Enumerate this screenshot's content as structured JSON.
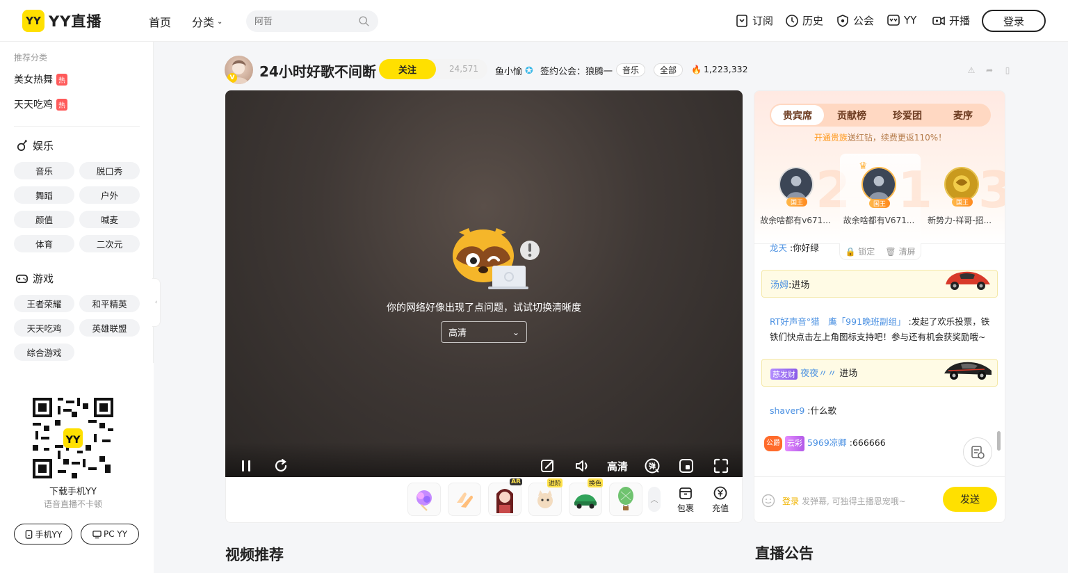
{
  "header": {
    "logo_badge": "YY",
    "logo_text": "YY直播",
    "nav_home": "首页",
    "nav_category": "分类",
    "search_placeholder": "阿哲",
    "nav_items": [
      "订阅",
      "历史",
      "公会",
      "YY",
      "开播"
    ],
    "login": "登录"
  },
  "sidebar": {
    "recommend_title": "推荐分类",
    "hot_items": [
      {
        "label": "美女热舞",
        "badge": "热"
      },
      {
        "label": "天天吃鸡",
        "badge": "热"
      }
    ],
    "entertainment": {
      "title": "娱乐",
      "items": [
        "音乐",
        "脱口秀",
        "舞蹈",
        "户外",
        "颜值",
        "喊麦",
        "体育",
        "二次元"
      ]
    },
    "games": {
      "title": "游戏",
      "items": [
        "王者荣耀",
        "和平精英",
        "天天吃鸡",
        "英雄联盟",
        "综合游戏"
      ]
    },
    "qr": {
      "caption": "下载手机YY",
      "sub": "语音直播不卡顿"
    },
    "download_buttons": [
      "手机YY",
      "PC YY"
    ]
  },
  "room": {
    "title": "24小时好歌不间断",
    "follow_label": "关注",
    "follow_count": "24,571",
    "anchor": "鱼小愉",
    "guild": "签约公会：狼腾一",
    "tags": [
      "音乐",
      "全部"
    ],
    "heat": "1,223,332"
  },
  "player": {
    "error_message": "你的网络好像出现了点问题，试试切换清晰度",
    "quality_selected": "高清",
    "quality_label": "高清",
    "danmaku_icon_label": "弹"
  },
  "gifts": {
    "items": [
      {
        "name": "gift-1",
        "tag": ""
      },
      {
        "name": "gift-2",
        "tag": ""
      },
      {
        "name": "gift-3",
        "tag": "AR"
      },
      {
        "name": "gift-4",
        "tag": "进阶"
      },
      {
        "name": "gift-5",
        "tag": "换色"
      },
      {
        "name": "gift-6",
        "tag": ""
      }
    ],
    "bag_label": "包裹",
    "recharge_label": "充值"
  },
  "chat": {
    "tabs": [
      "贵宾席",
      "贡献榜",
      "珍爱团",
      "麦序"
    ],
    "promo_highlight": "开通贵族",
    "promo_text": "送红钻，续费更返110%！",
    "guests": [
      {
        "rank": "2",
        "name": "故余啥都有v671...",
        "badge": "国王"
      },
      {
        "rank": "1",
        "name": "故余啥都有V671...",
        "badge": "国王"
      },
      {
        "rank": "3",
        "name": "新势力-祥哥-招...",
        "badge": "国王"
      }
    ],
    "tools": {
      "lock": "锁定",
      "clear": "清屏"
    },
    "messages": [
      {
        "type": "msg",
        "user": "龙天",
        "text": "你好绿"
      },
      {
        "type": "enter",
        "user": "汤姆",
        "text": "进场"
      },
      {
        "type": "msg",
        "user": "RT好声音°猎　鹰「991晚班副组」",
        "text": "发起了欢乐投票，铁铁们快点击左上角图标支持吧！参与还有机会获奖励哦~"
      },
      {
        "type": "enter",
        "badge": "慈发财",
        "user": "夜夜〃〃",
        "text": "进场"
      },
      {
        "type": "msg",
        "user": "shaver9",
        "text": "什么歌"
      },
      {
        "type": "msg",
        "guild_badge": "公爵",
        "badge": "云彩",
        "user": "5969凉卿",
        "text": "666666"
      }
    ],
    "input_login": "登录",
    "input_placeholder": "发弹幕, 可独得主播恩宠哦~",
    "send": "发送"
  },
  "sections": {
    "video_rec": "视频推荐",
    "announce": "直播公告"
  },
  "colors": {
    "brand_yellow": "#ffe000",
    "link_blue": "#4a90e2",
    "hot_red": "#ff5a5a"
  }
}
